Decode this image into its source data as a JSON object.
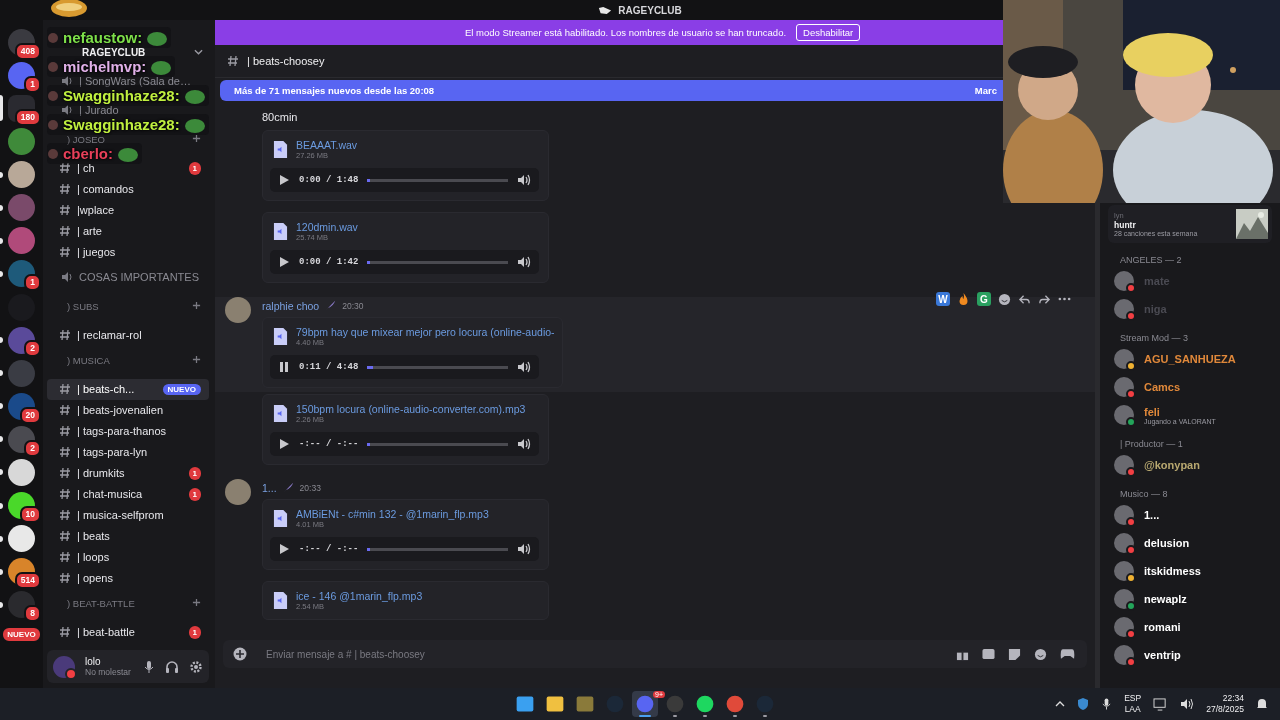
{
  "title_bar": {
    "title": "RAGEYCLUB"
  },
  "streamer_banner": {
    "text": "El modo Streamer está habilitado. Los nombres de usuario se han truncado.",
    "button": "Deshabilitar"
  },
  "servers": [
    {
      "color": "#3a3a40",
      "badge": "408",
      "selected": false,
      "unread": false
    },
    {
      "color": "#5865f2",
      "badge": "1",
      "selected": false,
      "unread": false
    },
    {
      "color": "#2a2a30",
      "badge": "180",
      "selected": true,
      "unread": false
    },
    {
      "color": "#3f8a3a",
      "selected": false,
      "unread": false
    },
    {
      "color": "#b8a898",
      "selected": false,
      "unread": true
    },
    {
      "color": "#7a4a6a",
      "selected": false,
      "unread": true
    },
    {
      "color": "#b04a7a",
      "selected": false,
      "unread": true
    },
    {
      "color": "#1e5a7a",
      "badge": "1",
      "selected": false,
      "unread": true
    },
    {
      "color": "#1a1a1e",
      "selected": false,
      "unread": false
    },
    {
      "color": "#5a4a9a",
      "badge": "2",
      "selected": false,
      "unread": true
    },
    {
      "color": "#3a3c44",
      "selected": false,
      "unread": true
    },
    {
      "color": "#1a4a8a",
      "badge": "20",
      "selected": false,
      "unread": true
    },
    {
      "color": "#4a4a50",
      "badge": "2",
      "selected": false,
      "unread": true
    },
    {
      "color": "#d8d8d8",
      "selected": false,
      "unread": true
    },
    {
      "color": "#4ad82a",
      "badge": "10",
      "selected": false,
      "unread": true
    },
    {
      "color": "#e8e8e8",
      "selected": false,
      "unread": true
    },
    {
      "color": "#d8842a",
      "badge": "514",
      "selected": false,
      "unread": true
    },
    {
      "color": "#2a2a2e",
      "badge": "8",
      "selected": false,
      "unread": true
    }
  ],
  "server_notice": "NUEVO",
  "stream_chat": [
    {
      "user": "nefaustow:",
      "color": "#7ee04a"
    },
    {
      "user": "michelmvp:",
      "color": "#e0b0e8"
    },
    {
      "user": "Swagginhaze28:",
      "color": "#c0f040"
    },
    {
      "user": "Swagginhaze28:",
      "color": "#c0f040"
    },
    {
      "user": "cberlo:",
      "color": "#e8405a"
    }
  ],
  "channel_sidebar": {
    "server_name": "RAGEYCLUB",
    "items": [
      {
        "kind": "voice",
        "label": "| SongWars (Sala de…"
      },
      {
        "kind": "voice",
        "label": "| Jurado"
      },
      {
        "kind": "category",
        "label": ") JOSEO"
      },
      {
        "kind": "text",
        "label": "| ch",
        "selected": false,
        "badge": "1"
      },
      {
        "kind": "text",
        "label": "| comandos",
        "selected": false
      },
      {
        "kind": "text",
        "label": "|wplace",
        "selected": false
      },
      {
        "kind": "text",
        "label": "| arte",
        "selected": false
      },
      {
        "kind": "text",
        "label": "| juegos",
        "selected": false
      },
      {
        "kind": "voice",
        "label": "COSAS IMPORTANTES"
      },
      {
        "kind": "category",
        "label": ") SUBS"
      },
      {
        "kind": "text",
        "label": "| reclamar-rol",
        "selected": false
      },
      {
        "kind": "category",
        "label": ") MUSICA"
      },
      {
        "kind": "text",
        "label": "| beats-ch...",
        "selected": true,
        "tag": "NUEVO"
      },
      {
        "kind": "text",
        "label": "| beats-jovenalien",
        "selected": false
      },
      {
        "kind": "text",
        "label": "| tags-para-thanos",
        "selected": false
      },
      {
        "kind": "text",
        "label": "| tags-para-lyn",
        "selected": false
      },
      {
        "kind": "text",
        "label": "| drumkits",
        "selected": false,
        "badge": "1"
      },
      {
        "kind": "text",
        "label": "| chat-musica",
        "selected": false,
        "badge": "1"
      },
      {
        "kind": "text",
        "label": "| musica-selfprom",
        "selected": false
      },
      {
        "kind": "text",
        "label": "| beats",
        "selected": false
      },
      {
        "kind": "text",
        "label": "| loops",
        "selected": false
      },
      {
        "kind": "text",
        "label": "| opens",
        "selected": false
      },
      {
        "kind": "category",
        "label": ") BEAT-BATTLE"
      },
      {
        "kind": "text",
        "label": "| beat-battle",
        "selected": false,
        "badge": "1"
      }
    ]
  },
  "user_panel": {
    "name": "lolo",
    "status": "No molestar"
  },
  "channel_header": {
    "name": "| beats-choosey"
  },
  "new_messages_bar": {
    "text": "Más de 71 mensajes nuevos desde las 20:08",
    "action": "Marc"
  },
  "messages": [
    {
      "kind": "continuation",
      "text": "80cmin",
      "attachments": [
        {
          "name": "BEAAAT.wav",
          "size": "27.26 MB",
          "time": "0:00 / 1:48",
          "playing": false,
          "level": 0.02
        },
        {
          "name": "120dmin.wav",
          "size": "25.74 MB",
          "time": "0:00 / 1:42",
          "playing": false,
          "level": 0.02
        }
      ]
    },
    {
      "kind": "message",
      "author": "ralphie choo",
      "time": "20:30",
      "reactions": [
        {
          "kind": "letter",
          "label": "W"
        },
        {
          "kind": "fire"
        },
        {
          "kind": "letter",
          "label": "G"
        }
      ],
      "attachments": [
        {
          "name": "79bpm hay que mixear mejor pero locura (online-audio-",
          "size": "4.40 MB",
          "time": "0:11 / 4:48",
          "playing": true,
          "level": 0.04
        }
      ]
    },
    {
      "kind": "continuation",
      "attachments": [
        {
          "name": "150bpm locura (online-audio-converter.com).mp3",
          "size": "2.26 MB",
          "time": "-:-- / -:--",
          "playing": false,
          "level": 0.02
        }
      ]
    },
    {
      "kind": "message",
      "author": "1...",
      "time": "20:33",
      "attachments": [
        {
          "name": "AMBiENt - c#min 132 - @1marin_flp.mp3",
          "size": "4.01 MB",
          "time": "-:-- / -:--",
          "playing": false,
          "level": 0.02
        },
        {
          "name": "ice - 146 @1marin_flp.mp3",
          "size": "2.54 MB"
        }
      ]
    }
  ],
  "message_input": {
    "placeholder": "Enviar mensaje a # | beats-choosey"
  },
  "activity_card": {
    "user": "lyn",
    "title": "huntr",
    "subtitle": "28 canciones esta semana"
  },
  "member_groups": [
    {
      "label": "ANGELES — 2",
      "color": "#4a4a52",
      "members": [
        {
          "name": "mate",
          "color": "#f23f43"
        },
        {
          "name": "niga",
          "color": "#f23f43"
        }
      ]
    },
    {
      "label": "Stream Mod — 3",
      "color": "#e0883a",
      "members": [
        {
          "name": "AGU_SANHUEZA",
          "color": "#f0b232"
        },
        {
          "name": "Camcs",
          "color": "#f23f43"
        },
        {
          "name": "feli",
          "color": "#23a55a",
          "activity": "Jugando a VALORANT"
        }
      ]
    },
    {
      "label": "| Productor — 1",
      "color": "#b8a870",
      "members": [
        {
          "name": "@konypan",
          "color": "#f23f43"
        }
      ]
    },
    {
      "label": "Musico — 8",
      "color": "#ffffff",
      "members": [
        {
          "name": "1...",
          "color": "#f23f43"
        },
        {
          "name": "delusion",
          "color": "#f23f43"
        },
        {
          "name": "itskidmess",
          "color": "#f0b232"
        },
        {
          "name": "newaplz",
          "color": "#23a55a"
        },
        {
          "name": "romani",
          "color": "#f23f43"
        },
        {
          "name": "ventrip",
          "color": "#f23f43"
        }
      ]
    }
  ],
  "taskbar": {
    "apps": [
      {
        "kind": "windows",
        "running": false,
        "active": false
      },
      {
        "kind": "folder",
        "running": false,
        "active": false
      },
      {
        "kind": "game",
        "running": false,
        "active": false
      },
      {
        "kind": "steam",
        "running": false,
        "active": false
      },
      {
        "kind": "discord",
        "running": true,
        "active": true,
        "badge": "9+"
      },
      {
        "kind": "recorder",
        "running": true,
        "active": false
      },
      {
        "kind": "spotify",
        "running": true,
        "active": false
      },
      {
        "kind": "browser",
        "running": true,
        "active": false
      },
      {
        "kind": "steam",
        "running": true,
        "active": false
      }
    ],
    "language": "ESP",
    "region": "LAA",
    "time": "22:34",
    "date": "27/8/2025"
  }
}
